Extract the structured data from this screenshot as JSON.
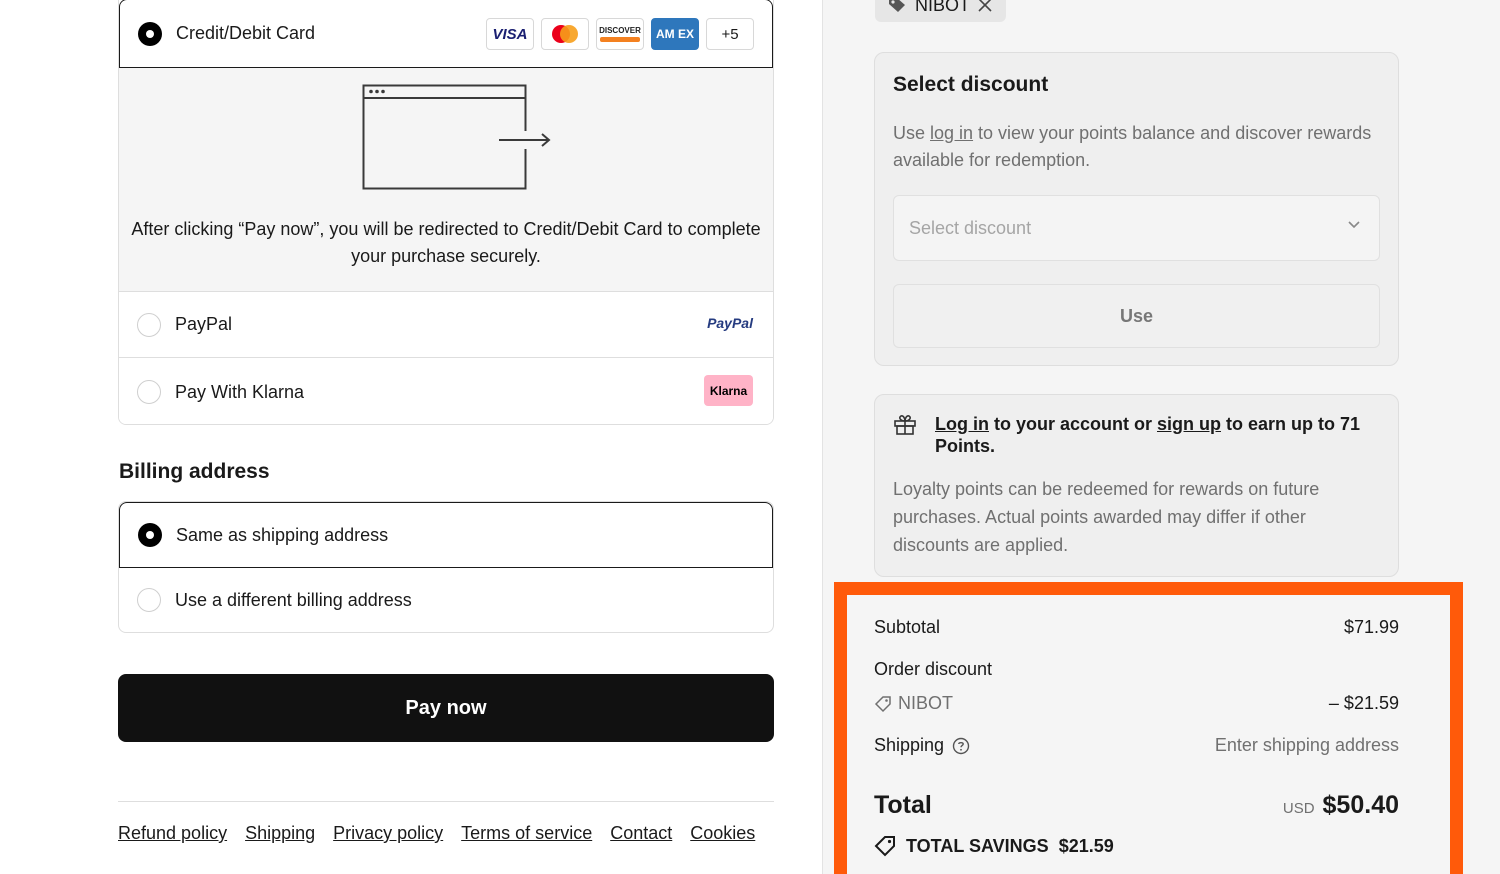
{
  "payment": {
    "card_label": "Credit/Debit Card",
    "brands": {
      "visa": "VISA",
      "discover": "DISCOVER",
      "amex": "AM EX",
      "more": "+5"
    },
    "redirect_text": "After clicking “Pay now”, you will be redirected to Credit/Debit Card to complete your purchase securely.",
    "paypal_label": "PayPal",
    "paypal_logo": "PayPal",
    "klarna_label": "Pay With Klarna",
    "klarna_logo": "Klarna"
  },
  "billing": {
    "title": "Billing address",
    "same_label": "Same as shipping address",
    "different_label": "Use a different billing address"
  },
  "pay_button": "Pay now",
  "footer": {
    "links": [
      "Refund policy",
      "Shipping",
      "Privacy policy",
      "Terms of service",
      "Contact",
      "Cookies"
    ]
  },
  "discount_chip": "NIBOT",
  "discount": {
    "title": "Select discount",
    "desc_pre": "Use ",
    "desc_link": "log in",
    "desc_post": " to view your points balance and discover rewards available for redemption.",
    "select_placeholder": "Select discount",
    "use_button": "Use"
  },
  "loyalty": {
    "login_link": "Log in",
    "mid": " to your account or ",
    "signup_link": "sign up",
    "post": " to earn up to 71 Points.",
    "text": "Loyalty points can be redeemed for rewards on future purchases. Actual points awarded may differ if other discounts are applied."
  },
  "summary": {
    "subtotal_label": "Subtotal",
    "subtotal_value": "$71.99",
    "order_discount_label": "Order discount",
    "code": "NIBOT",
    "discount_value": "– $21.59",
    "shipping_label": "Shipping",
    "shipping_value": "Enter shipping address",
    "total_label": "Total",
    "currency": "USD",
    "total_value": "$50.40",
    "savings_label": "TOTAL SAVINGS",
    "savings_value": "$21.59"
  },
  "colors": {
    "highlight": "#ff5a0a",
    "button": "#111111",
    "klarna": "#ffb3c7"
  }
}
